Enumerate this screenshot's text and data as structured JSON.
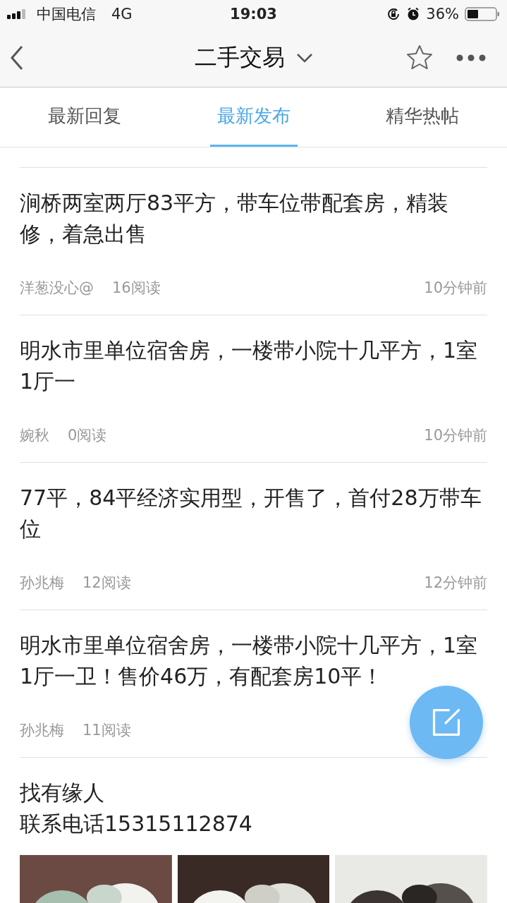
{
  "status_bar": {
    "carrier": "中国电信",
    "network": "4G",
    "time": "19:03",
    "battery_percent": "36%"
  },
  "nav": {
    "title": "二手交易"
  },
  "tabs": [
    {
      "label": "最新回复",
      "selected": false
    },
    {
      "label": "最新发布",
      "selected": true
    },
    {
      "label": "精华热帖",
      "selected": false
    }
  ],
  "posts": [
    {
      "title": "涧桥两室两厅83平方，带车位带配套房，精装修，着急出售",
      "author": "洋葱没心@",
      "reads": "16阅读",
      "time": "10分钟前"
    },
    {
      "title": "明水市里单位宿舍房，一楼带小院十几平方，1室1厅一",
      "author": "婉秋",
      "reads": "0阅读",
      "time": "10分钟前"
    },
    {
      "title": "77平，84平经济实用型，开售了，首付28万带车位",
      "author": "孙兆梅",
      "reads": "12阅读",
      "time": "12分钟前"
    },
    {
      "title": "明水市里单位宿舍房，一楼带小院十几平方，1室1厅一卫！售价46万，有配套房10平！",
      "author": "孙兆梅",
      "reads": "11阅读"
    },
    {
      "lines": [
        "找有缘人",
        "联系电话15315112874"
      ],
      "images": [
        {
          "kind": "picture"
        },
        {
          "kind": "picture"
        },
        {
          "kind": "picture"
        }
      ]
    }
  ]
}
